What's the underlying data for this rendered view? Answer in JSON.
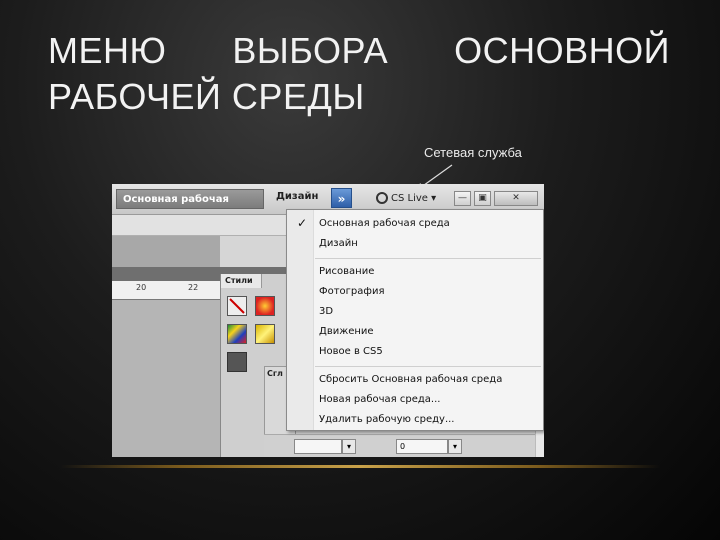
{
  "slide": {
    "title_line1_words": [
      "МЕНЮ",
      "ВЫБОРА",
      "ОСНОВНОЙ"
    ],
    "title_line2": "РАБОЧЕЙ СРЕДЫ",
    "callout": "Сетевая служба"
  },
  "app": {
    "workspace_button": "Основная рабочая среде",
    "design_label": "Дизайн",
    "expand_label": "»",
    "cs_live_label": "CS Live ▾",
    "window_buttons": [
      "—",
      "▣",
      "✕"
    ],
    "ruler_ticks": [
      "20",
      "22"
    ],
    "styles_tab": "Стили",
    "panel2_label": "Сгл",
    "tracking_value": "0"
  },
  "menu": {
    "checked_item": "Основная рабочая среда",
    "items": [
      "Основная рабочая среда",
      "Дизайн",
      "Рисование",
      "Фотография",
      "3D",
      "Движение",
      "Новое в CS5",
      "Сбросить Основная рабочая среда",
      "Новая рабочая среда...",
      "Удалить рабочую среду..."
    ]
  },
  "colors": {
    "accent_blue": "#2f5fa8",
    "divider_gold": "#c9a24a",
    "background": "#1c1c1c"
  }
}
